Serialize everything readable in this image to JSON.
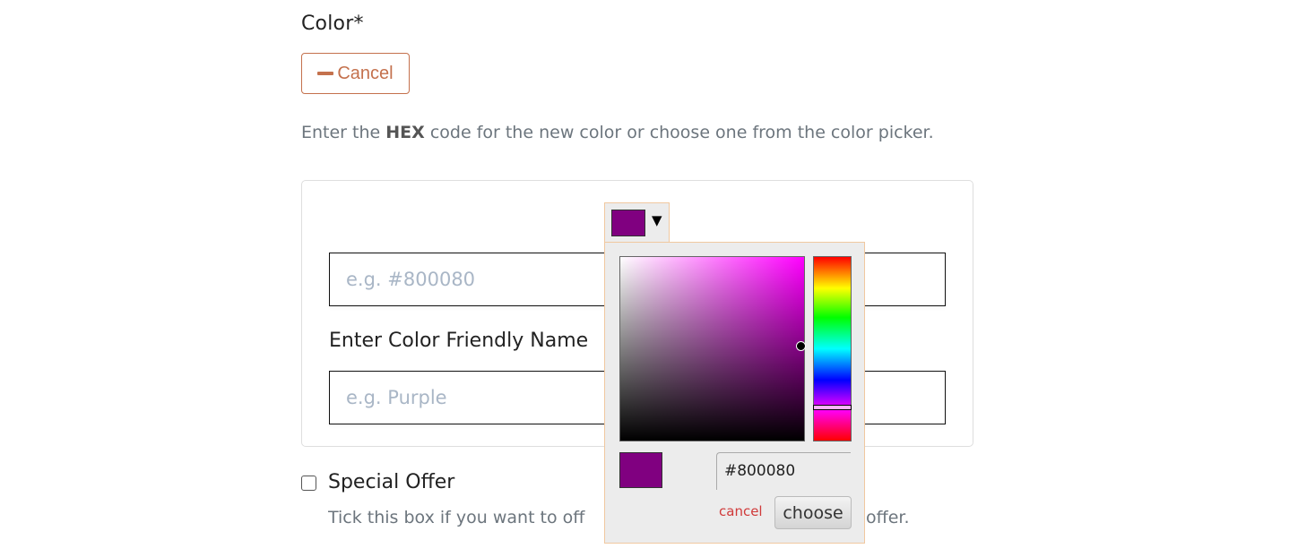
{
  "form": {
    "color_label": "Color*",
    "cancel_button": "Cancel",
    "help_prefix": "Enter the ",
    "help_bold": "HEX",
    "help_suffix": " code for the new color or choose one from the color picker.",
    "hex_input": {
      "value": "",
      "placeholder": "e.g. #800080"
    },
    "friendly_name_label": "Enter Color Friendly Name",
    "friendly_name_input": {
      "value": "",
      "placeholder": "e.g. Purple"
    },
    "special_offer": {
      "label": "Special Offer",
      "checked": false,
      "help_visible_left": "Tick this box if you want to off",
      "help_visible_right": "offer."
    }
  },
  "color_picker": {
    "trigger_arrow": "▼",
    "selected_color": "#800080",
    "hex_value": "#800080",
    "cancel_label": "cancel",
    "choose_label": "choose",
    "hue_degrees": 300,
    "saturation_percent": 100,
    "value_percent": 50
  }
}
